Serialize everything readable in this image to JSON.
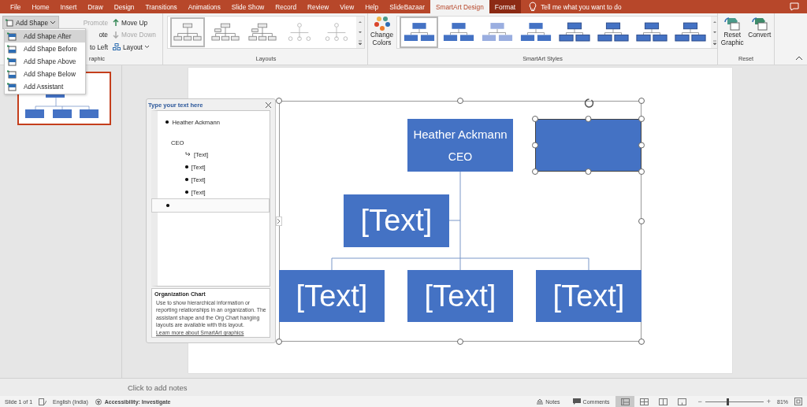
{
  "tabs": [
    {
      "label": "File",
      "selected": false,
      "contextual": false
    },
    {
      "label": "Home",
      "selected": false,
      "contextual": false
    },
    {
      "label": "Insert",
      "selected": false,
      "contextual": false
    },
    {
      "label": "Draw",
      "selected": false,
      "contextual": false
    },
    {
      "label": "Design",
      "selected": false,
      "contextual": false
    },
    {
      "label": "Transitions",
      "selected": false,
      "contextual": false
    },
    {
      "label": "Animations",
      "selected": false,
      "contextual": false
    },
    {
      "label": "Slide Show",
      "selected": false,
      "contextual": false
    },
    {
      "label": "Record",
      "selected": false,
      "contextual": false
    },
    {
      "label": "Review",
      "selected": false,
      "contextual": false
    },
    {
      "label": "View",
      "selected": false,
      "contextual": false
    },
    {
      "label": "Help",
      "selected": false,
      "contextual": false
    },
    {
      "label": "SlideBazaar",
      "selected": false,
      "contextual": false
    },
    {
      "label": "SmartArt Design",
      "selected": true,
      "contextual": true
    },
    {
      "label": "Format",
      "selected": false,
      "contextual": true
    }
  ],
  "tell_me": "Tell me what you want to do",
  "create_graphic": {
    "add_shape": "Add Shape",
    "left_items": [
      {
        "label": "Promote",
        "disabled": true
      },
      {
        "label": "ote",
        "disabled": false
      },
      {
        "label": "to Left",
        "disabled": false
      }
    ],
    "right_items": [
      {
        "label": "Move Up",
        "disabled": false,
        "kind": "up"
      },
      {
        "label": "Move Down",
        "disabled": true,
        "kind": "down"
      },
      {
        "label": "Layout",
        "disabled": false,
        "kind": "layout"
      }
    ],
    "group_label": "raphic"
  },
  "add_shape_menu": [
    {
      "label": "Add Shape After",
      "selected": true
    },
    {
      "label": "Add Shape Before",
      "selected": false
    },
    {
      "label": "Add Shape Above",
      "selected": false
    },
    {
      "label": "Add Shape Below",
      "selected": false
    },
    {
      "label": "Add Assistant",
      "selected": false
    }
  ],
  "layouts": {
    "thumbnails": [
      {
        "selected": true
      },
      {
        "selected": false
      },
      {
        "selected": false
      },
      {
        "selected": false
      },
      {
        "selected": false
      }
    ],
    "group_label": "Layouts"
  },
  "smartart_styles": {
    "change_colors": "Change Colors",
    "thumbnails": [
      {
        "selected": true
      },
      {
        "selected": false
      },
      {
        "selected": false
      },
      {
        "selected": false
      },
      {
        "selected": false
      },
      {
        "selected": false
      },
      {
        "selected": false
      },
      {
        "selected": false
      }
    ],
    "group_label": "SmartArt Styles"
  },
  "reset": {
    "buttons": [
      "Reset Graphic",
      "Convert"
    ],
    "group_label": "Reset"
  },
  "text_pane": {
    "title": "Type your text here",
    "items": [
      {
        "text": "Heather Ackmann",
        "second_line": "CEO",
        "selected": false,
        "children": [
          {
            "text": "[Text]",
            "kind": "assistant"
          },
          {
            "text": "[Text]",
            "kind": "bullet"
          },
          {
            "text": "[Text]",
            "kind": "bullet"
          },
          {
            "text": "[Text]",
            "kind": "bullet"
          }
        ]
      },
      {
        "selected": true
      }
    ],
    "info_title": "Organization Chart",
    "info_body": "Use to show hierarchical information or reporting relationships in an organization. The assistant shape and the Org Chart hanging layouts are available with this layout.",
    "info_link": "Learn more about SmartArt graphics"
  },
  "diagram": {
    "nodes": [
      {
        "text": "Heather Ackmann",
        "second_line": "CEO",
        "selected": false
      },
      {
        "selected": true
      },
      {
        "text": "[Text]",
        "selected": false
      },
      {
        "text": "[Text]",
        "selected": false
      },
      {
        "text": "[Text]",
        "selected": false
      },
      {
        "text": "[Text]",
        "selected": false
      }
    ]
  },
  "notes_placeholder": "Click to add notes",
  "status_bar": {
    "slide": "Slide 1 of 1",
    "language": "English (India)",
    "accessibility": "Accessibility: Investigate",
    "notes": "Notes",
    "comments": "Comments",
    "views": [
      {
        "selected": true
      },
      {
        "selected": false
      },
      {
        "selected": false
      },
      {
        "selected": false
      }
    ],
    "zoom_minus": "−",
    "zoom_plus": "+",
    "zoom": {
      "level": 0.38
    },
    "zoom_text": "81%"
  }
}
